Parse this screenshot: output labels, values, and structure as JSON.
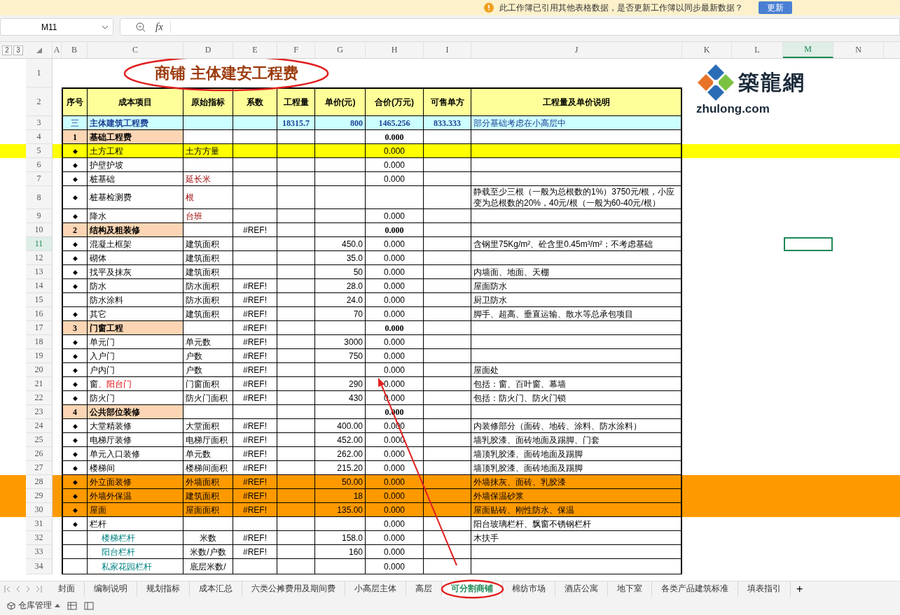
{
  "notice": {
    "text": "此工作簿已引用其他表格数据，是否更新工作簿以同步最新数据？",
    "button": "更新"
  },
  "formula_bar": {
    "cell": "M11",
    "fx": "fx"
  },
  "outline_levels": [
    "2",
    "3"
  ],
  "columns": [
    {
      "label": "A",
      "selected": false
    },
    {
      "label": "B",
      "selected": false
    },
    {
      "label": "C",
      "selected": false
    },
    {
      "label": "D",
      "selected": false
    },
    {
      "label": "E",
      "selected": false
    },
    {
      "label": "F",
      "selected": false
    },
    {
      "label": "G",
      "selected": false
    },
    {
      "label": "H",
      "selected": false
    },
    {
      "label": "I",
      "selected": false
    },
    {
      "label": "J",
      "selected": false
    },
    {
      "label": "K",
      "selected": false
    },
    {
      "label": "L",
      "selected": false
    },
    {
      "label": "M",
      "selected": true
    },
    {
      "label": "N",
      "selected": false
    }
  ],
  "title": {
    "row": "1",
    "text": "商铺 主体建安工程费"
  },
  "logo": {
    "name": "築龍網",
    "site": "zhulong.com"
  },
  "header": {
    "row": "2",
    "cells": [
      "序号",
      "成本项目",
      "原始指标",
      "系数",
      "工程量",
      "单价(元)",
      "合价(万元)",
      "可售单方",
      "工程量及单价说明"
    ]
  },
  "rows": [
    {
      "row": "3",
      "kind": "group",
      "selected": false,
      "seq": "三",
      "item": "主体建筑工程费",
      "qty": "18315.7",
      "price": "800",
      "total": "1465.256",
      "unit": "833.333",
      "note": "部分基础考虑在小高层中"
    },
    {
      "row": "4",
      "kind": "section",
      "selected": false,
      "seq": "1",
      "item": "基础工程费",
      "total": "0.000"
    },
    {
      "row": "5",
      "kind": "item",
      "selected": false,
      "color": "#ffff00",
      "seq": "◆",
      "item": "土方工程",
      "metric": "土方方量",
      "total": "0.000"
    },
    {
      "row": "6",
      "kind": "item",
      "selected": false,
      "seq": "◆",
      "item": "护壁护坡",
      "total": "0.000"
    },
    {
      "row": "7",
      "kind": "item",
      "selected": false,
      "seq": "◆",
      "item": "桩基础",
      "metric": "延长米",
      "metric_red": true,
      "total": "0.000"
    },
    {
      "row": "8",
      "kind": "item",
      "selected": false,
      "seq": "◆",
      "item": "桩基检测费",
      "metric": "根",
      "metric_red": true,
      "note": "静载至少三根（一般为总根数的1%）3750元/根，小应变为总根数的20%，40元/根（一般为60-40元/根）"
    },
    {
      "row": "9",
      "kind": "item",
      "selected": false,
      "seq": "◆",
      "item": "降水",
      "metric": "台班",
      "metric_red": true,
      "total": "0.000"
    },
    {
      "row": "10",
      "kind": "section",
      "selected": false,
      "seq": "2",
      "item": "结构及粗装修",
      "coef": "#REF!",
      "total": "0.000"
    },
    {
      "row": "11",
      "kind": "item",
      "selected": true,
      "seq": "◆",
      "item": "混凝土框架",
      "metric": "建筑面积",
      "price": "450.0",
      "total": "0.000",
      "note": "含钢里75Kg/m²、砼含里0.45m³/m²；不考虑基础"
    },
    {
      "row": "12",
      "kind": "item",
      "selected": false,
      "seq": "◆",
      "item": "砌体",
      "metric": "建筑面积",
      "price": "35.0",
      "total": "0.000"
    },
    {
      "row": "13",
      "kind": "item",
      "selected": false,
      "seq": "◆",
      "item": "找平及抹灰",
      "metric": "建筑面积",
      "price": "50",
      "total": "0.000",
      "note": "内墙面、地面、天棚"
    },
    {
      "row": "14",
      "kind": "item",
      "selected": false,
      "seq": "◆",
      "item": "防水",
      "metric": "防水面积",
      "coef": "#REF!",
      "price": "28.0",
      "total": "0.000",
      "note": "屋面防水"
    },
    {
      "row": "15",
      "kind": "item",
      "selected": false,
      "item": "防水涂料",
      "metric": "防水面积",
      "coef": "#REF!",
      "price": "24.0",
      "total": "0.000",
      "note": "厨卫防水"
    },
    {
      "row": "16",
      "kind": "item",
      "selected": false,
      "seq": "◆",
      "item": "其它",
      "metric": "建筑面积",
      "coef": "#REF!",
      "price": "70",
      "total": "0.000",
      "note": "脚手、超高、垂直运输、散水等总承包项目"
    },
    {
      "row": "17",
      "kind": "section",
      "selected": false,
      "seq": "3",
      "item": "门窗工程",
      "coef": "#REF!",
      "total": "0.000"
    },
    {
      "row": "18",
      "kind": "item",
      "selected": false,
      "seq": "◆",
      "item": "单元门",
      "metric": "单元数",
      "coef": "#REF!",
      "price": "3000",
      "total": "0.000"
    },
    {
      "row": "19",
      "kind": "item",
      "selected": false,
      "seq": "◆",
      "item": "入户门",
      "metric": "户数",
      "coef": "#REF!",
      "price": "750",
      "total": "0.000"
    },
    {
      "row": "20",
      "kind": "item",
      "selected": false,
      "seq": "◆",
      "item": "户内门",
      "metric": "户数",
      "coef": "#REF!",
      "total": "0.000",
      "note": "屋面处"
    },
    {
      "row": "21",
      "kind": "item",
      "selected": false,
      "seq": "◆",
      "item": "窗",
      "item_red_tail": "、阳台门",
      "metric": "门窗面积",
      "coef": "#REF!",
      "price": "290",
      "total": "0.000",
      "note": "包括：窗、百叶窗、幕墙"
    },
    {
      "row": "22",
      "kind": "item",
      "selected": false,
      "seq": "◆",
      "item": "防火门",
      "metric": "防火门面积",
      "coef": "#REF!",
      "price": "430",
      "total": "0.000",
      "note": "包括：防火门、防火门锁"
    },
    {
      "row": "23",
      "kind": "section",
      "selected": false,
      "seq": "4",
      "item": "公共部位装修",
      "total": "0.000"
    },
    {
      "row": "24",
      "kind": "item",
      "selected": false,
      "seq": "◆",
      "item": "大堂精装修",
      "metric": "大堂面积",
      "coef": "#REF!",
      "price": "400.00",
      "total": "0.000",
      "note": "内装修部分（面砖、地砖、涂料、防水涂料）"
    },
    {
      "row": "25",
      "kind": "item",
      "selected": false,
      "seq": "◆",
      "item": "电梯厅装修",
      "metric": "电梯厅面积",
      "coef": "#REF!",
      "price": "452.00",
      "total": "0.000",
      "note": "墙乳胶漆、面砖地面及踢脚、门套"
    },
    {
      "row": "26",
      "kind": "item",
      "selected": false,
      "seq": "◆",
      "item": "单元入口装修",
      "metric": "单元数",
      "coef": "#REF!",
      "price": "262.00",
      "total": "0.000",
      "note": "墙顶乳胶漆、面砖地面及踢脚"
    },
    {
      "row": "27",
      "kind": "item",
      "selected": false,
      "seq": "◆",
      "item": "楼梯间",
      "metric": "楼梯间面积",
      "coef": "#REF!",
      "price": "215.20",
      "total": "0.000",
      "note": "墙顶乳胶漆、面砖地面及踢脚"
    },
    {
      "row": "28",
      "kind": "item",
      "selected": false,
      "color": "#ff9900",
      "seq": "◆",
      "item": "外立面装修",
      "metric": "外墙面积",
      "coef": "#REF!",
      "price": "50.00",
      "total": "0.000",
      "note": "外墙抹灰、面砖、乳胶漆"
    },
    {
      "row": "29",
      "kind": "item",
      "selected": false,
      "color": "#ff9900",
      "seq": "◆",
      "item": "外墙外保温",
      "metric": "建筑面积",
      "coef": "#REF!",
      "price": "18",
      "total": "0.000",
      "note": "外墙保温砂浆"
    },
    {
      "row": "30",
      "kind": "item",
      "selected": false,
      "color": "#ff9900",
      "seq": "◆",
      "item": "屋面",
      "metric": "屋面面积",
      "coef": "#REF!",
      "price": "135.00",
      "total": "0.000",
      "note": "屋面贴砖、刚性防水、保温"
    },
    {
      "row": "31",
      "kind": "item",
      "selected": false,
      "seq": "◆",
      "item": "栏杆",
      "total": "0.000",
      "note": "阳台玻璃栏杆、飘窗不锈钢栏杆"
    },
    {
      "row": "32",
      "kind": "sub",
      "selected": false,
      "item": "楼梯栏杆",
      "metric": "米数",
      "coef": "#REF!",
      "price": "158.0",
      "total": "0.000",
      "note": "木扶手"
    },
    {
      "row": "33",
      "kind": "sub",
      "selected": false,
      "item": "阳台栏杆",
      "metric": "米数/户数",
      "coef": "#REF!",
      "price": "160",
      "total": "0.000"
    },
    {
      "row": "34",
      "kind": "sub",
      "selected": false,
      "item": "私家花园栏杆",
      "metric": "底层米数/",
      "total": "0.000"
    }
  ],
  "sheet_tabs": [
    {
      "label": "封面",
      "selected": false
    },
    {
      "label": "编制说明",
      "selected": false
    },
    {
      "label": "规划指标",
      "selected": false
    },
    {
      "label": "成本汇总",
      "selected": false
    },
    {
      "label": "六类公摊费用及期间费",
      "selected": false
    },
    {
      "label": "小高层主体",
      "selected": false
    },
    {
      "label": "高层",
      "selected": false
    },
    {
      "label": "可分割商铺",
      "selected": true
    },
    {
      "label": "棉纺市场",
      "selected": false
    },
    {
      "label": "酒店公寓",
      "selected": false
    },
    {
      "label": "地下室",
      "selected": false
    },
    {
      "label": "各类产品建筑标准",
      "selected": false
    },
    {
      "label": "填表指引",
      "selected": false
    }
  ],
  "add_tab": "+",
  "status_bar": {
    "label": "仓库管理"
  }
}
